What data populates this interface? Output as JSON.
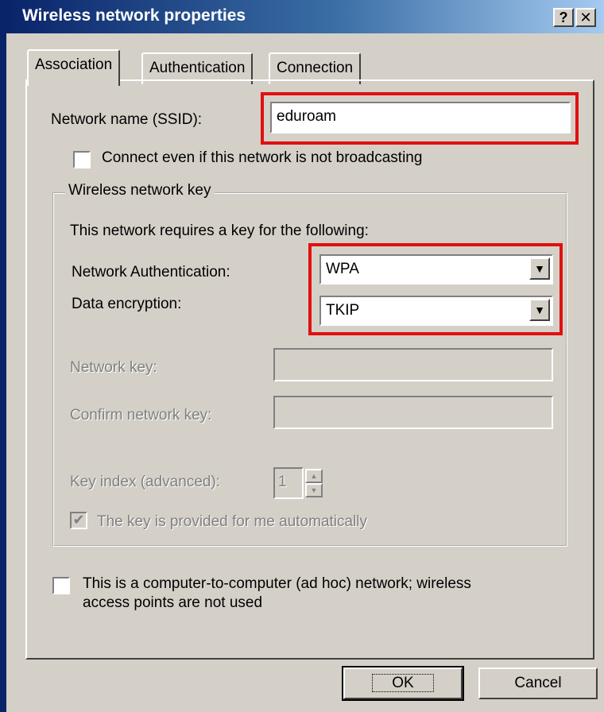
{
  "window": {
    "title": "Wireless network properties",
    "help_label": "?",
    "close_label": "✕"
  },
  "tabs": [
    {
      "label": "Association"
    },
    {
      "label": "Authentication"
    },
    {
      "label": "Connection"
    }
  ],
  "association": {
    "ssid_label": "Network name (SSID):",
    "ssid_value": "eduroam",
    "hidden_checkbox_label": "Connect even if this network is not broadcasting",
    "hidden_checked": false
  },
  "wireless_key": {
    "group_title": "Wireless network key",
    "intro": "This network requires a key for the following:",
    "auth_label": "Network Authentication:",
    "auth_value": "WPA",
    "encryption_label": "Data encryption:",
    "encryption_value": "TKIP",
    "network_key_label": "Network key:",
    "network_key_value": "",
    "confirm_key_label": "Confirm network key:",
    "confirm_key_value": "",
    "key_index_label": "Key index (advanced):",
    "key_index_value": "1",
    "auto_key_label": "The key is provided for me automatically",
    "auto_key_checked": true
  },
  "adhoc": {
    "label_line1": "This is a computer-to-computer (ad hoc) network; wireless",
    "label_line2": "access points are not used",
    "checked": false
  },
  "buttons": {
    "ok": "OK",
    "cancel": "Cancel"
  },
  "icons": {
    "dropdown": "▼",
    "check": "✔",
    "spin_up": "▲",
    "spin_down": "▼"
  },
  "colors": {
    "highlight_box": "#e01010",
    "title_bar": "#0a246a",
    "face": "#d4d0c8"
  }
}
